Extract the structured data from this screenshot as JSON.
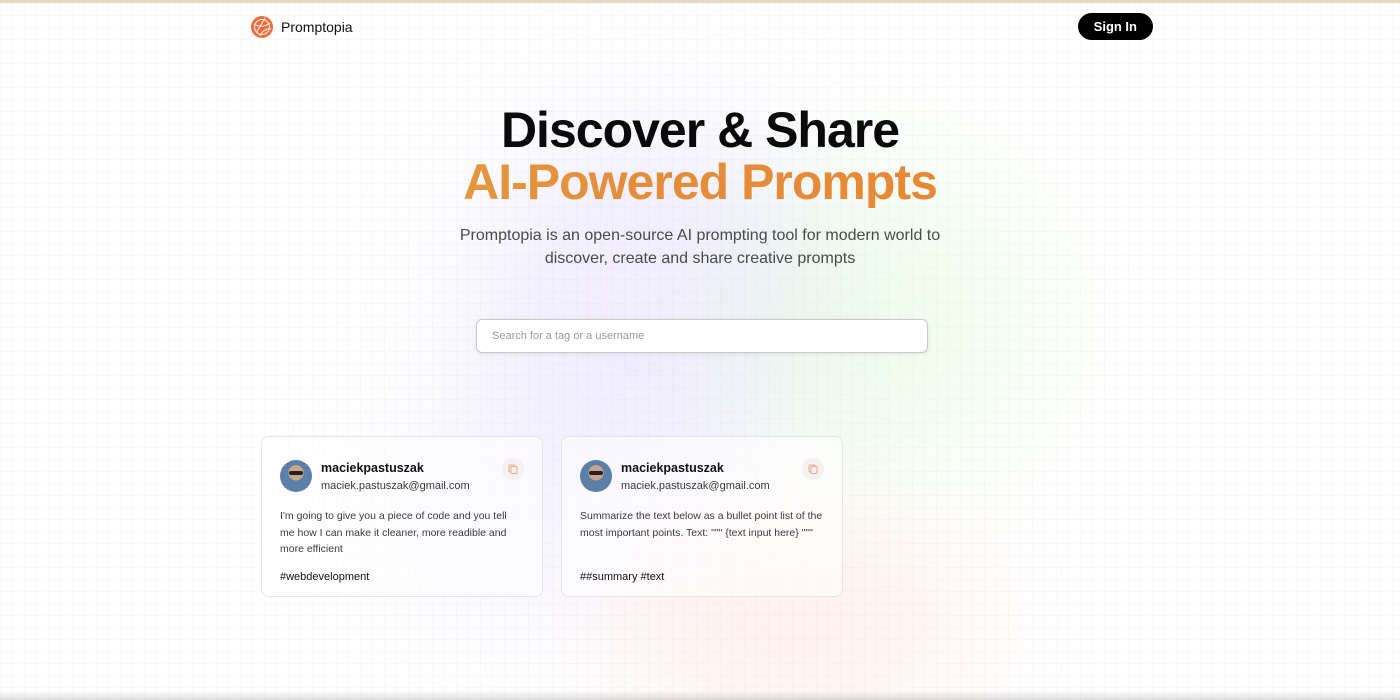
{
  "brand": {
    "name": "Promptopia",
    "logo_icon": "promptopia-logo-icon",
    "accent_color": "#ef6a3a"
  },
  "nav": {
    "signin_label": "Sign In"
  },
  "hero": {
    "title_line1": "Discover & Share",
    "title_line2": "AI-Powered Prompts",
    "subtitle": "Promptopia is an open-source AI prompting tool for modern world to discover, create and share creative prompts",
    "gradient_colors": [
      "#e0b04a",
      "#e48e3a",
      "#ef7f2f"
    ]
  },
  "search": {
    "placeholder": "Search for a tag or a username",
    "value": ""
  },
  "prompts": [
    {
      "username": "maciekpastuszak",
      "email": "maciek.pastuszak@gmail.com",
      "text": "I'm going to give you a piece of code and you tell me how I can make it cleaner, more readible and more efficient",
      "tag": "#webdevelopment",
      "copy_icon": "copy-icon"
    },
    {
      "username": "maciekpastuszak",
      "email": "maciek.pastuszak@gmail.com",
      "text": "Summarize the text below as a bullet point list of the most important points. Text: \"\"\" {text input here} \"\"\"",
      "tag": "##summary #text",
      "copy_icon": "copy-icon"
    }
  ]
}
